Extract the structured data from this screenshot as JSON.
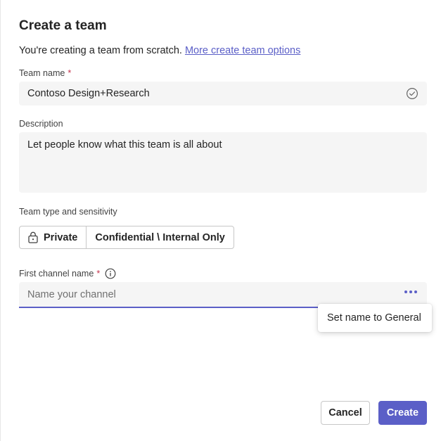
{
  "dialog": {
    "title": "Create a team",
    "subtitle_text": "You're creating a team from scratch. ",
    "subtitle_link": "More create team options"
  },
  "team_name": {
    "label": "Team name",
    "required_mark": "*",
    "value": "Contoso Design+Research",
    "status_icon": "check-circle-icon"
  },
  "description": {
    "label": "Description",
    "placeholder": "Let people know what this team is all about"
  },
  "team_type": {
    "label": "Team type and sensitivity",
    "privacy_icon": "lock-icon",
    "privacy": "Private",
    "sensitivity": "Confidential \\ Internal Only"
  },
  "channel": {
    "label": "First channel name",
    "required_mark": "*",
    "info_icon": "info-icon",
    "placeholder": "Name your channel",
    "more_icon": "more-horizontal-icon"
  },
  "popup": {
    "item": "Set name to General"
  },
  "footer": {
    "cancel_label": "Cancel",
    "create_label": "Create"
  },
  "colors": {
    "accent": "#5b5fc7",
    "required": "#c4314b",
    "field_bg": "#f5f5f5"
  }
}
